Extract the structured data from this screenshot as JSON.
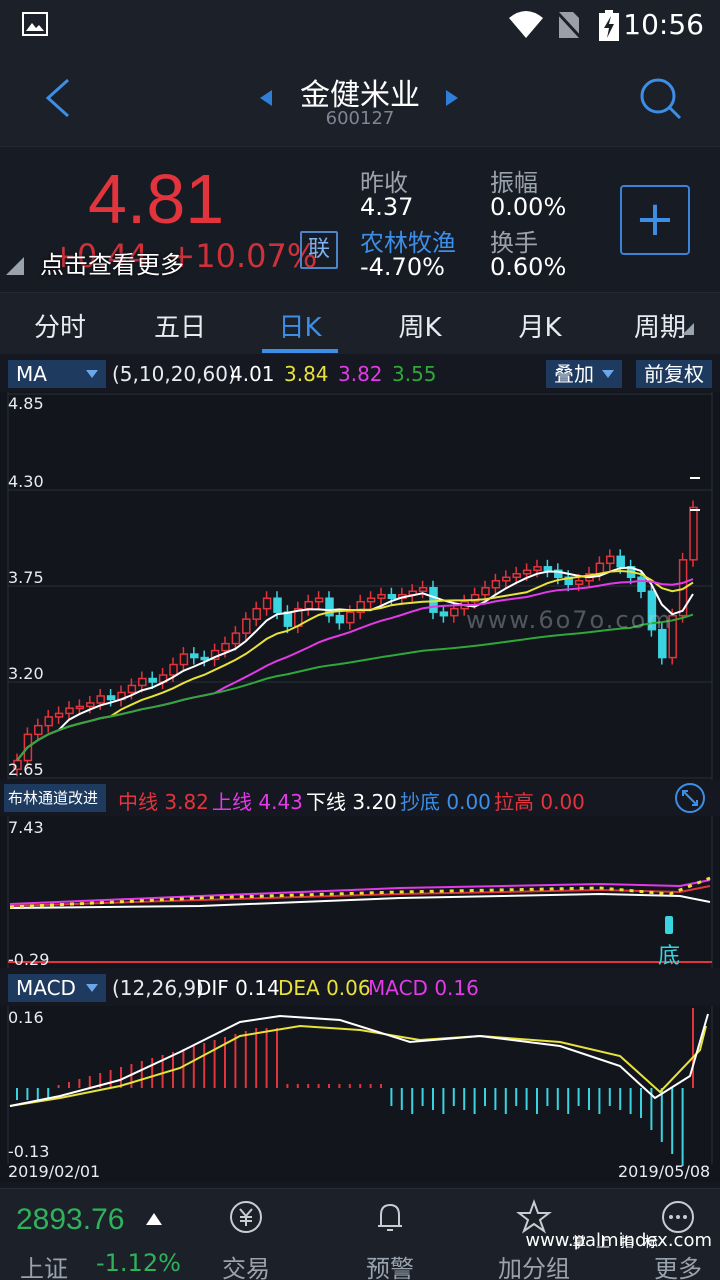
{
  "status": {
    "time": "10:56"
  },
  "header": {
    "name": "金健米业",
    "code": "600127"
  },
  "quote": {
    "price": "4.81",
    "change": "+0.44",
    "change_pct": "+10.07%",
    "tip": "点击查看更多",
    "lian": "联",
    "prev_close_label": "昨收",
    "prev_close": "4.37",
    "amp_label": "振幅",
    "amp": "0.00%",
    "sector": "农林牧渔",
    "sector_chg": "-4.70%",
    "turnover_label": "换手",
    "turnover": "0.60%"
  },
  "tabs": [
    "分时",
    "五日",
    "日K",
    "周K",
    "月K",
    "周期"
  ],
  "ma_bar": {
    "name": "MA",
    "params": "(5,10,20,60)",
    "ma5": "4.01",
    "ma10": "3.84",
    "ma20": "3.82",
    "ma60": "3.55",
    "overlay": "叠加",
    "adjust": "前复权"
  },
  "main_axis": {
    "top": "4.85",
    "t2": "4.30",
    "t3": "3.75",
    "t4": "3.20",
    "bottom": "2.65"
  },
  "watermark_mid": "www.6o7o.com",
  "boll_bar": {
    "name": "布林通道改进",
    "mid_label": "中线",
    "mid": "3.82",
    "up_label": "上线",
    "up": "4.43",
    "low_label": "下线",
    "low": "3.20",
    "buy_label": "抄底",
    "buy": "0.00",
    "pull_label": "拉高",
    "pull": "0.00"
  },
  "boll_axis": {
    "top": "7.43",
    "bottom": "-0.29",
    "signal": "底"
  },
  "macd_bar": {
    "name": "MACD",
    "params": "(12,26,9)",
    "dif_label": "DIF",
    "dif": "0.14",
    "dea_label": "DEA",
    "dea": "0.06",
    "macd_label": "MACD",
    "macd": "0.16"
  },
  "macd_axis": {
    "top": "0.16",
    "bottom": "-0.13",
    "date_start": "2019/02/01",
    "date_end": "2019/05/08"
  },
  "bottom": {
    "index_value": "2893.76",
    "index_name": "上证",
    "index_pct": "-1.12%",
    "nav": [
      "交易",
      "预警",
      "加分组",
      "更多"
    ],
    "watermark_top": "掌上指标",
    "watermark": "www.palmindex.com"
  },
  "colors": {
    "up": "#e2343c",
    "down": "#39d4e0",
    "accent": "#3c8ee6",
    "ma5": "#ffffff",
    "ma10": "#e8e23a",
    "ma20": "#e23ae8",
    "ma60": "#2fa83a"
  }
}
